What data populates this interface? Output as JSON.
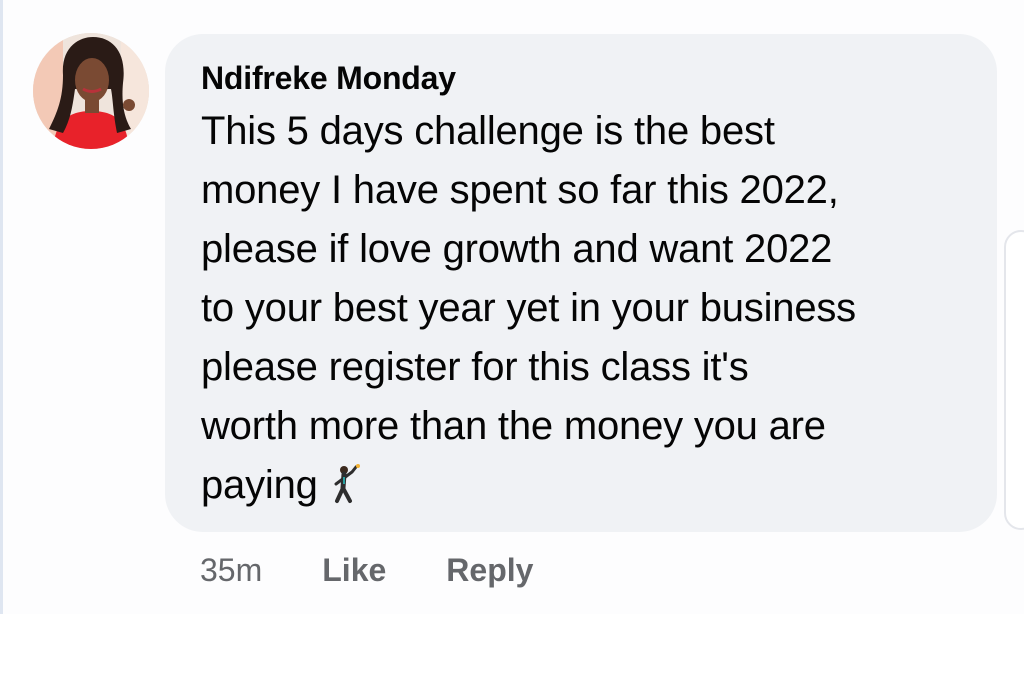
{
  "comment": {
    "author": "Ndifreke Monday",
    "text": "This 5 days challenge is the best\nmoney I have spent so far this 2022,\nplease if  love growth and want 2022\nto your best year yet in your business\nplease register for this class it's\nworth more than the money you are\npaying",
    "emoji": "man-dancing-icon"
  },
  "actions": {
    "time": "35m",
    "like_label": "Like",
    "reply_label": "Reply"
  },
  "colors": {
    "bubble": "#f0f2f5",
    "text": "#050505",
    "meta": "#65676b",
    "page": "#ffffff"
  }
}
